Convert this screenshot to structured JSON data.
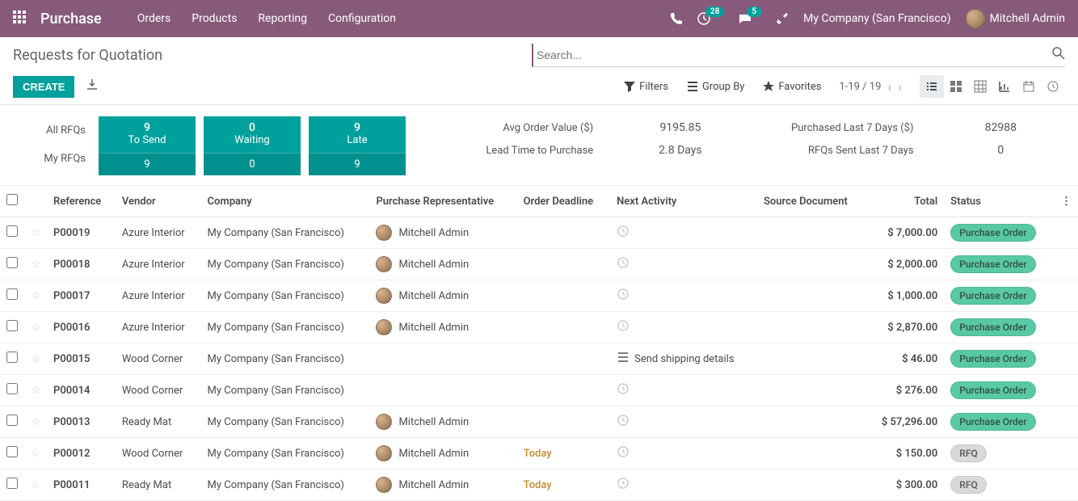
{
  "navbar": {
    "brand": "Purchase",
    "menu": [
      "Orders",
      "Products",
      "Reporting",
      "Configuration"
    ],
    "activities_badge": "28",
    "messages_badge": "5",
    "company": "My Company (San Francisco)",
    "user": "Mitchell Admin"
  },
  "control": {
    "title": "Requests for Quotation",
    "search_placeholder": "Search...",
    "create": "CREATE",
    "filters": "Filters",
    "groupby": "Group By",
    "favorites": "Favorites",
    "pager": "1-19 / 19"
  },
  "dashboard": {
    "rows": [
      "All RFQs",
      "My RFQs"
    ],
    "cards": [
      {
        "top_num": "9",
        "top_label": "To Send",
        "bottom": "9"
      },
      {
        "top_num": "0",
        "top_label": "Waiting",
        "bottom": "0"
      },
      {
        "top_num": "9",
        "top_label": "Late",
        "bottom": "9"
      }
    ],
    "metrics": [
      {
        "label": "Avg Order Value ($)",
        "value": "9195.85"
      },
      {
        "label": "Purchased Last 7 Days ($)",
        "value": "82988"
      },
      {
        "label": "Lead Time to Purchase",
        "value": "2.8  Days"
      },
      {
        "label": "RFQs Sent Last 7 Days",
        "value": "0"
      }
    ]
  },
  "columns": {
    "reference": "Reference",
    "vendor": "Vendor",
    "company": "Company",
    "rep": "Purchase Representative",
    "deadline": "Order Deadline",
    "activity": "Next Activity",
    "source": "Source Document",
    "total": "Total",
    "status": "Status"
  },
  "status_labels": {
    "po": "Purchase Order",
    "rfq": "RFQ"
  },
  "rows": [
    {
      "ref": "P00019",
      "vendor": "Azure Interior",
      "company": "My Company (San Francisco)",
      "rep": "Mitchell Admin",
      "deadline": "",
      "activity": "clock",
      "source": "",
      "total": "$ 7,000.00",
      "status": "po"
    },
    {
      "ref": "P00018",
      "vendor": "Azure Interior",
      "company": "My Company (San Francisco)",
      "rep": "Mitchell Admin",
      "deadline": "",
      "activity": "clock",
      "source": "",
      "total": "$ 2,000.00",
      "status": "po"
    },
    {
      "ref": "P00017",
      "vendor": "Azure Interior",
      "company": "My Company (San Francisco)",
      "rep": "Mitchell Admin",
      "deadline": "",
      "activity": "clock",
      "source": "",
      "total": "$ 1,000.00",
      "status": "po"
    },
    {
      "ref": "P00016",
      "vendor": "Azure Interior",
      "company": "My Company (San Francisco)",
      "rep": "Mitchell Admin",
      "deadline": "",
      "activity": "clock",
      "source": "",
      "total": "$ 2,870.00",
      "status": "po"
    },
    {
      "ref": "P00015",
      "vendor": "Wood Corner",
      "company": "My Company (San Francisco)",
      "rep": "",
      "deadline": "",
      "activity": "send",
      "activity_text": "Send shipping details",
      "source": "",
      "total": "$ 46.00",
      "status": "po"
    },
    {
      "ref": "P00014",
      "vendor": "Wood Corner",
      "company": "My Company (San Francisco)",
      "rep": "",
      "deadline": "",
      "activity": "clock",
      "source": "",
      "total": "$ 276.00",
      "status": "po"
    },
    {
      "ref": "P00013",
      "vendor": "Ready Mat",
      "company": "My Company (San Francisco)",
      "rep": "Mitchell Admin",
      "deadline": "",
      "activity": "clock",
      "source": "",
      "total": "$ 57,296.00",
      "status": "po"
    },
    {
      "ref": "P00012",
      "vendor": "Wood Corner",
      "company": "My Company (San Francisco)",
      "rep": "Mitchell Admin",
      "deadline": "Today",
      "activity": "clock",
      "source": "",
      "total": "$ 150.00",
      "status": "rfq"
    },
    {
      "ref": "P00011",
      "vendor": "Ready Mat",
      "company": "My Company (San Francisco)",
      "rep": "Mitchell Admin",
      "deadline": "Today",
      "activity": "clock",
      "source": "",
      "total": "$ 300.00",
      "status": "rfq"
    }
  ]
}
